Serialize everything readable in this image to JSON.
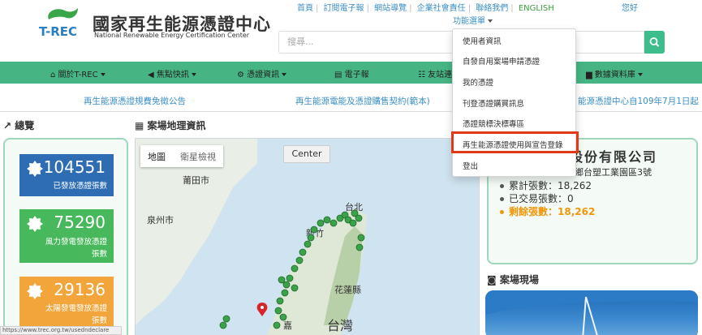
{
  "logo": {
    "mark": "T-REC",
    "title_zh": "國家再生能源憑證中心",
    "title_en": "National Renewable Energy Certification Center"
  },
  "top_links": [
    "首頁",
    "訂閱電子報",
    "網站導覽",
    "企業社會責任",
    "聯絡我們",
    "ENGLISH"
  ],
  "greeting": "您好",
  "function_menu": "功能選單",
  "search": {
    "placeholder": "搜尋..."
  },
  "nav": [
    "關於T-REC",
    "焦點快訊",
    "憑證資訊",
    "電子報",
    "友站連",
    "數據資料庫"
  ],
  "announcements": [
    "再生能源憑證規費免徵公告",
    "再生能源電能及憑證購售契約(範本)",
    "能源憑證中心自109年7月1日起"
  ],
  "overview": {
    "title": "總覽",
    "cards": [
      {
        "value": "104551",
        "label": "已發放憑證張數",
        "color": "#2e6db4"
      },
      {
        "value": "75290",
        "label_lines": [
          "風力發電發放憑證",
          "張數"
        ],
        "color": "#48b85c"
      },
      {
        "value": "29136",
        "label_lines": [
          "太陽發電發放憑證",
          "張數"
        ],
        "color": "#f1a53a"
      }
    ]
  },
  "map": {
    "title": "案場地理資訊",
    "tabs": [
      "地圖",
      "衛星檢視"
    ],
    "center_button": "Center",
    "labels": [
      "莆田市",
      "泉州市",
      "台北",
      "新竹",
      "花蓮縣",
      "台灣",
      "嘉"
    ]
  },
  "site_info": {
    "company": "股份有限公司",
    "address": "地址：雲林縣麥寮鄉台塑工業園區3號",
    "stats": [
      {
        "label": "累計張數：",
        "value": "18,262"
      },
      {
        "label": "已交易張數：",
        "value": "0"
      },
      {
        "label": "剩餘張數：",
        "value": "18,262"
      }
    ]
  },
  "site_photo_title": "案場現場",
  "dropdown": [
    "使用者資訊",
    "自發自用案場申請憑證",
    "我的憑證",
    "刊登憑證購買訊息",
    "憑證競標決標專區",
    "再生能源憑證使用與宣告登錄",
    "登出"
  ],
  "status_url": "https://www.trec.org.tw/usedndeclare",
  "colors": {
    "nav_green": "#47b583",
    "highlight_red": "#e03a1a",
    "remaining_orange": "#f0960a"
  }
}
